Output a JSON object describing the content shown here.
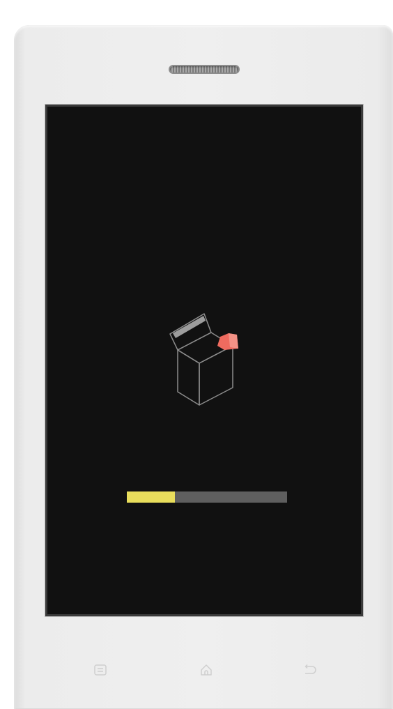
{
  "device": {
    "frame_color": "#ececec",
    "screen_color": "#111111"
  },
  "boot_screen": {
    "icon": "open-box-icon",
    "icon_accent_color": "#ef6b5f",
    "progress": {
      "fraction": 0.3,
      "fill_color": "#e9de5c",
      "track_color": "#5f5f5f"
    }
  },
  "hardware_keys": [
    {
      "icon": "menu-icon"
    },
    {
      "icon": "home-icon"
    },
    {
      "icon": "back-icon"
    }
  ]
}
